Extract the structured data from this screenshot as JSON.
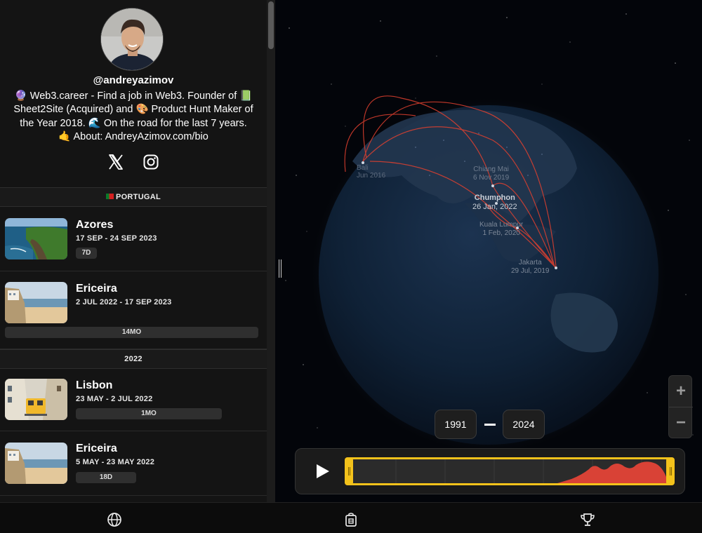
{
  "profile": {
    "username": "@andreyazimov",
    "bio": "🔮 Web3.career - Find a job in Web3. Founder of 📗 Sheet2Site (Acquired) and 🎨 Product Hunt Maker of the Year 2018. 🌊 On the road for the last 7 years. 🤙 About: AndreyAzimov.com/bio",
    "socials": [
      {
        "icon": "x-icon"
      },
      {
        "icon": "instagram-icon"
      }
    ]
  },
  "sections": {
    "portugal": "PORTUGAL",
    "y2022": "2022"
  },
  "trips": [
    {
      "name": "Azores",
      "dates": "17 SEP - 24 SEP 2023",
      "duration": "7D",
      "duration_fraction": 0.08
    },
    {
      "name": "Ericeira",
      "dates": "2 JUL 2022 - 17 SEP 2023",
      "duration": "14MO",
      "duration_fraction": 1.0
    },
    {
      "name": "Lisbon",
      "dates": "23 MAY - 2 JUL 2022",
      "duration": "1MO",
      "duration_fraction": 0.78
    },
    {
      "name": "Ericeira",
      "dates": "5 MAY - 23 MAY 2022",
      "duration": "18D",
      "duration_fraction": 0.33
    }
  ],
  "map": {
    "labels": [
      {
        "place": "Bali",
        "date": "Jun 2016"
      },
      {
        "place": "Chiang Mai",
        "date": "6 Nov 2019"
      },
      {
        "place": "Chumphon",
        "date": "26 Jan, 2022"
      },
      {
        "place": "Kuala Lumpur",
        "date": "1 Feb, 2020"
      },
      {
        "place": "Jakarta",
        "date": "29 Jul, 2019"
      }
    ]
  },
  "timeline": {
    "start_year": "1991",
    "end_year": "2024",
    "zoom_in": "+",
    "zoom_out": "−"
  },
  "bottom_tabs": [
    {
      "icon": "globe-icon"
    },
    {
      "icon": "passport-icon"
    },
    {
      "icon": "trophy-icon"
    }
  ],
  "colors": {
    "accent_yellow": "#f3c21b",
    "route_red": "#e0402f",
    "background": "#141414"
  }
}
